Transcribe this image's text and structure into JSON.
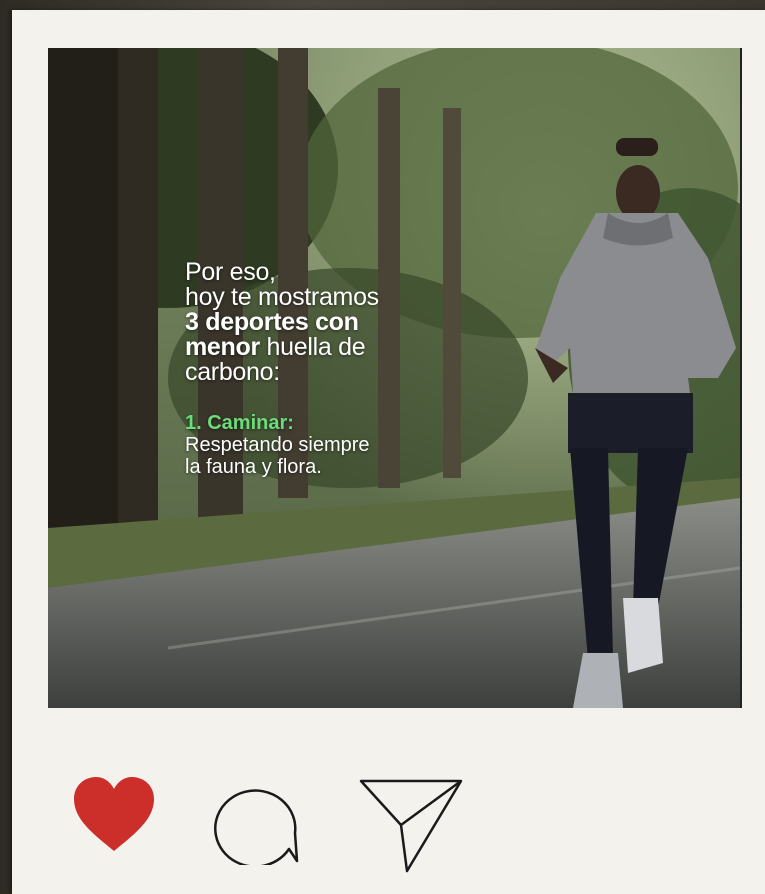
{
  "post": {
    "overlay": {
      "line1": "Por eso,",
      "line2": "hoy te mostramos",
      "line3": "3 deportes con",
      "line4_bold": "menor",
      "line4_rest": " huella de",
      "line5": "carbono:",
      "item1_title": "1. Caminar:",
      "item1_line1": "Respetando siempre",
      "item1_line2": "la fauna y flora."
    }
  },
  "actions": {
    "like_icon": "heart-icon",
    "comment_icon": "comment-icon",
    "share_icon": "send-icon",
    "like_color": "#cc2e2a"
  }
}
